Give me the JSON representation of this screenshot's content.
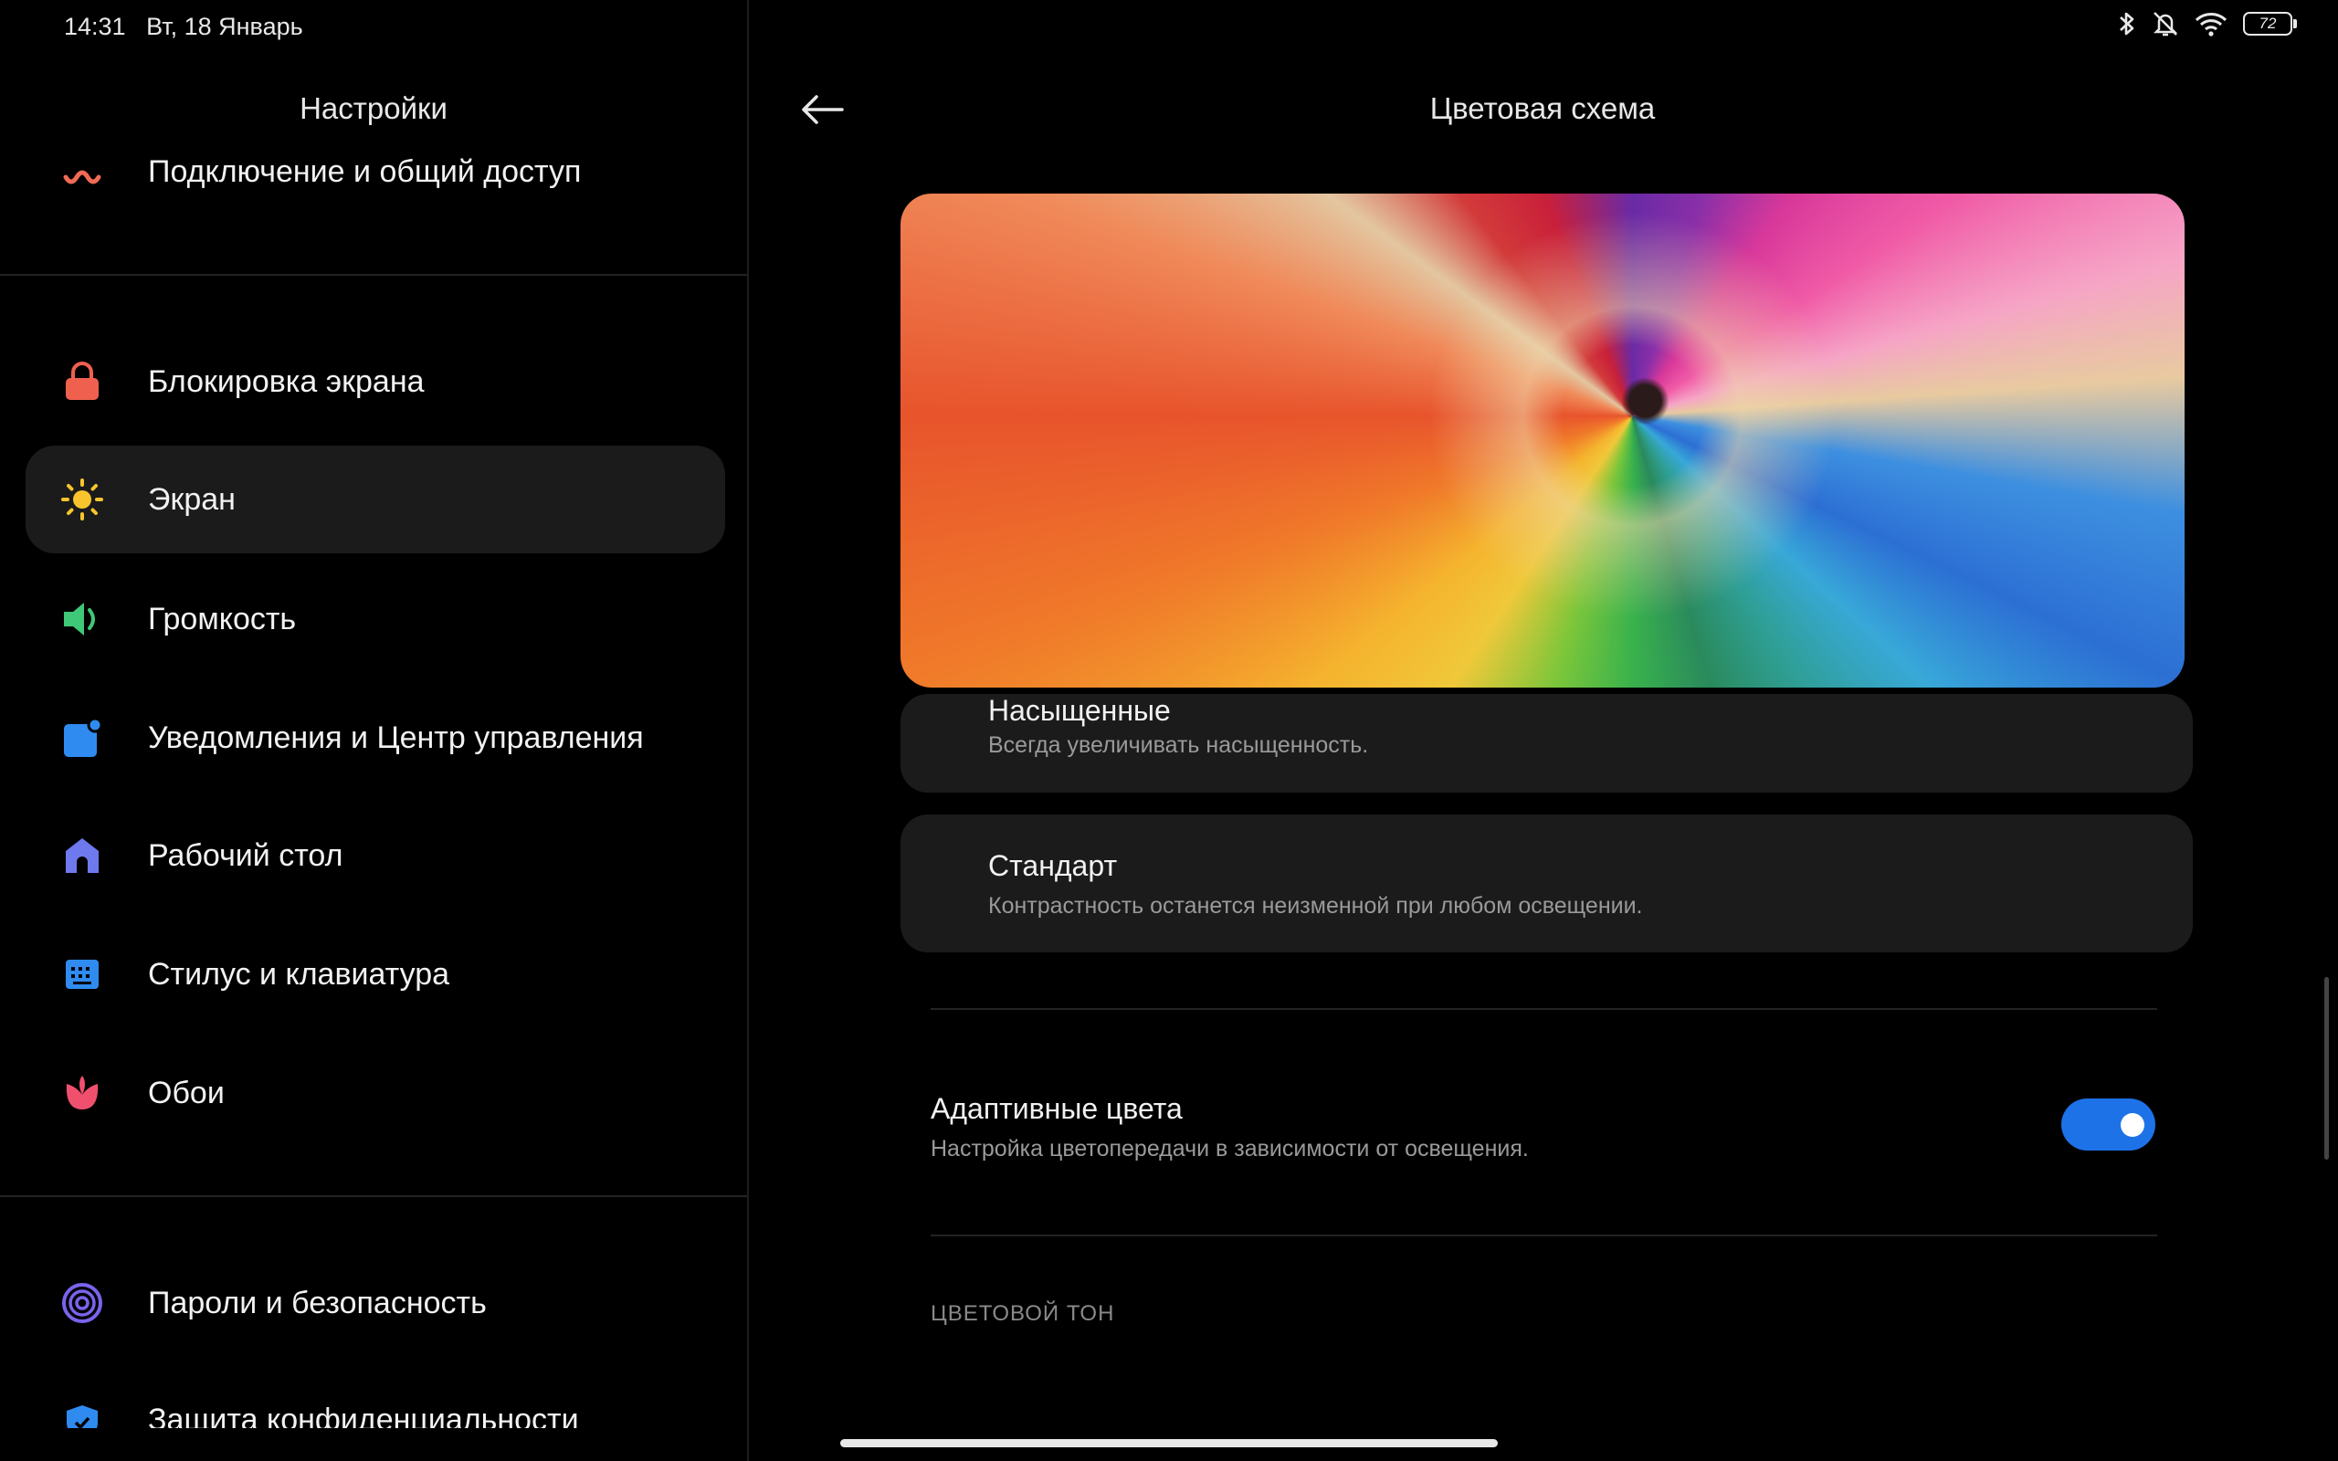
{
  "status_bar": {
    "time": "14:31",
    "date": "Вт, 18 Январь",
    "battery": "72",
    "icons": [
      "bluetooth-icon",
      "bell-off-icon",
      "wifi-icon",
      "battery-icon"
    ]
  },
  "left_pane": {
    "title": "Настройки",
    "items": [
      {
        "label": "Подключение и общий доступ",
        "icon": "share-icon"
      },
      {
        "label": "Блокировка экрана",
        "icon": "lock-icon"
      },
      {
        "label": "Экран",
        "icon": "sun-icon",
        "active": true
      },
      {
        "label": "Громкость",
        "icon": "speaker-icon"
      },
      {
        "label": "Уведомления и Центр управления",
        "icon": "notification-icon"
      },
      {
        "label": "Рабочий стол",
        "icon": "home-icon"
      },
      {
        "label": "Стилус и клавиатура",
        "icon": "keyboard-icon"
      },
      {
        "label": "Обои",
        "icon": "flower-icon"
      },
      {
        "label": "Пароли и безопасность",
        "icon": "fingerprint-icon"
      },
      {
        "label": "Защита конфиденциальности",
        "icon": "privacy-icon"
      }
    ]
  },
  "right_pane": {
    "title": "Цветовая схема",
    "options": [
      {
        "title": "Насыщенные",
        "subtitle": "Всегда увеличивать насыщенность."
      },
      {
        "title": "Стандарт",
        "subtitle": "Контрастность останется неизменной при любом освещении."
      }
    ],
    "adaptive": {
      "title": "Адаптивные цвета",
      "subtitle": "Настройка цветопередачи в зависимости от освещения.",
      "enabled": true
    },
    "section_header": "ЦВЕТОВОЙ ТОН"
  },
  "colors": {
    "accent": "#1d72e8",
    "card_bg": "#1b1b1b",
    "active_item_bg": "#1b1b1b"
  }
}
